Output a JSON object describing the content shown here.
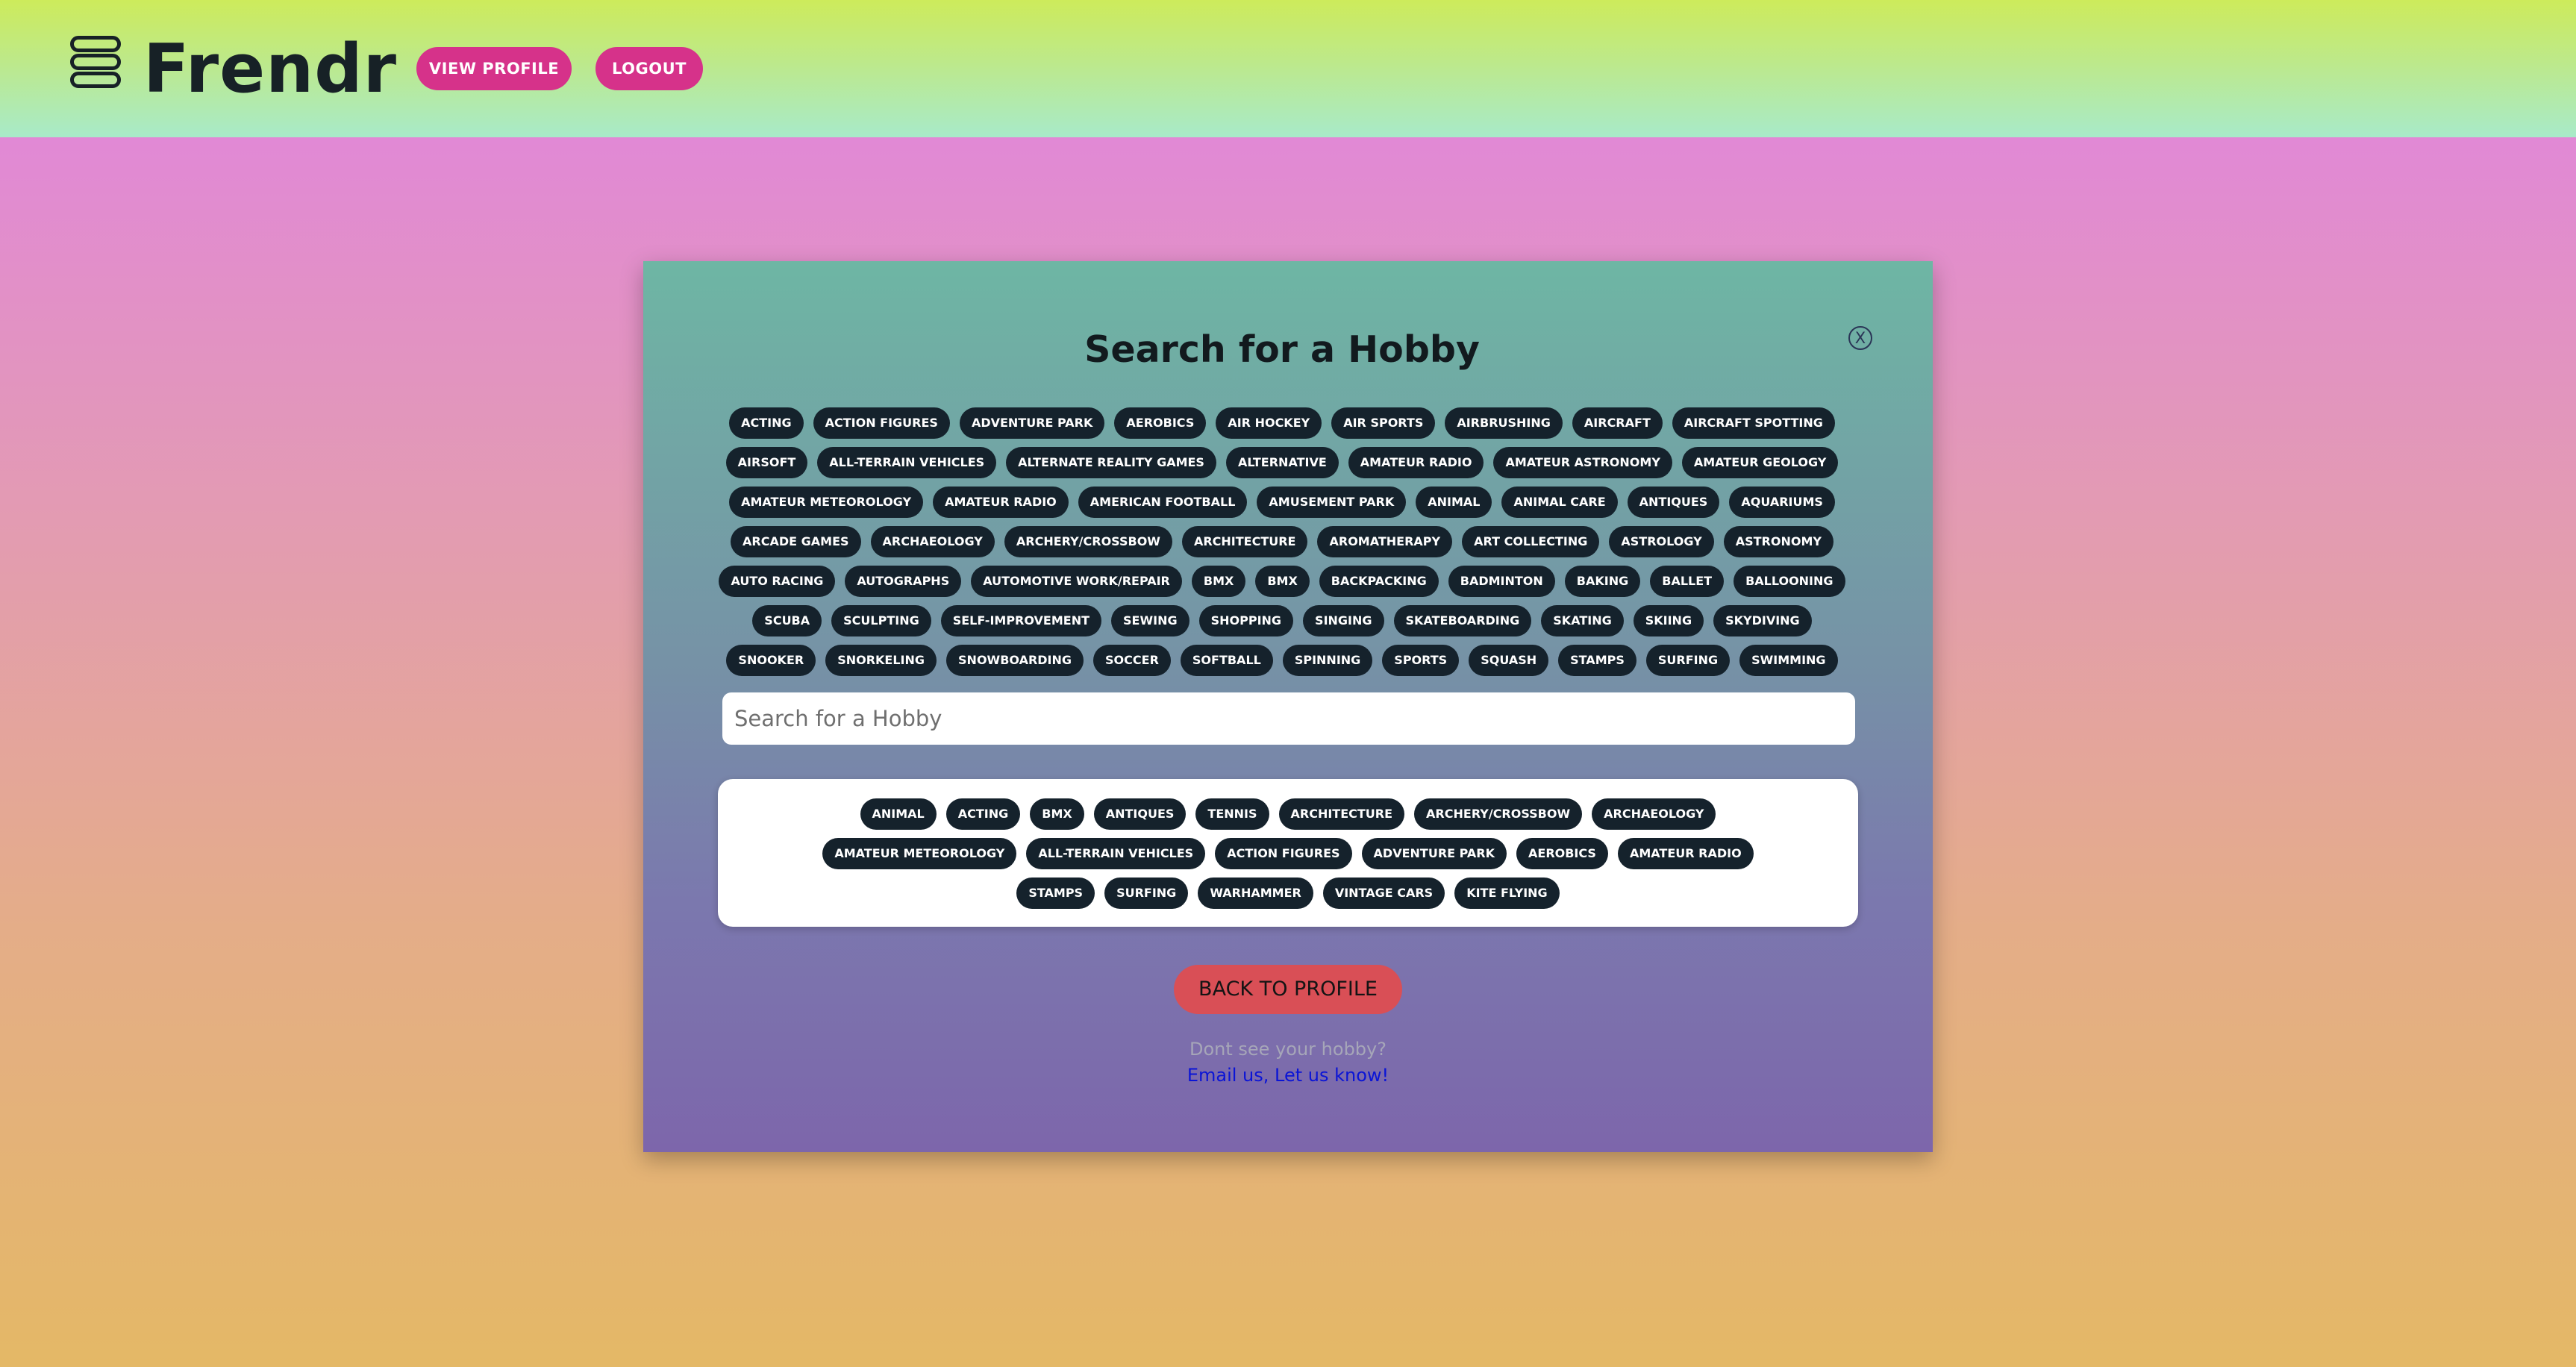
{
  "header": {
    "brand": "Frendr",
    "view_profile": "VIEW PROFILE",
    "logout": "LOGOUT"
  },
  "modal": {
    "title": "Search for a Hobby",
    "close_label": "X",
    "search_placeholder": "Search for a Hobby",
    "back_label": "BACK TO PROFILE",
    "hint": "Dont see your hobby?",
    "email_link": "Email us, Let us know!"
  },
  "hobby_rows": [
    [
      "ACTING",
      "ACTION FIGURES",
      "ADVENTURE PARK",
      "AEROBICS",
      "AIR HOCKEY",
      "AIR SPORTS",
      "AIRBRUSHING",
      "AIRCRAFT",
      "AIRCRAFT SPOTTING"
    ],
    [
      "AIRSOFT",
      "ALL-TERRAIN VEHICLES",
      "ALTERNATE REALITY GAMES",
      "ALTERNATIVE",
      "AMATEUR RADIO",
      "AMATEUR ASTRONOMY",
      "AMATEUR GEOLOGY"
    ],
    [
      "AMATEUR METEOROLOGY",
      "AMATEUR RADIO",
      "AMERICAN FOOTBALL",
      "AMUSEMENT PARK",
      "ANIMAL",
      "ANIMAL CARE",
      "ANTIQUES",
      "AQUARIUMS"
    ],
    [
      "ARCADE GAMES",
      "ARCHAEOLOGY",
      "ARCHERY/CROSSBOW",
      "ARCHITECTURE",
      "AROMATHERAPY",
      "ART COLLECTING",
      "ASTROLOGY",
      "ASTRONOMY"
    ],
    [
      "AUTO RACING",
      "AUTOGRAPHS",
      "AUTOMOTIVE WORK/REPAIR",
      "BMX",
      "BMX",
      "BACKPACKING",
      "BADMINTON",
      "BAKING",
      "BALLET",
      "BALLOONING"
    ],
    [
      "SCUBA",
      "SCULPTING",
      "SELF-IMPROVEMENT",
      "SEWING",
      "SHOPPING",
      "SINGING",
      "SKATEBOARDING",
      "SKATING",
      "SKIING",
      "SKYDIVING"
    ],
    [
      "SNOOKER",
      "SNORKELING",
      "SNOWBOARDING",
      "SOCCER",
      "SOFTBALL",
      "SPINNING",
      "SPORTS",
      "SQUASH",
      "STAMPS",
      "SURFING",
      "SWIMMING"
    ]
  ],
  "selected_rows": [
    [
      "ANIMAL",
      "ACTING",
      "BMX",
      "ANTIQUES",
      "TENNIS",
      "ARCHITECTURE",
      "ARCHERY/CROSSBOW",
      "ARCHAEOLOGY"
    ],
    [
      "AMATEUR METEOROLOGY",
      "ALL-TERRAIN VEHICLES",
      "ACTION FIGURES",
      "ADVENTURE PARK",
      "AEROBICS",
      "AMATEUR RADIO"
    ],
    [
      "STAMPS",
      "SURFING",
      "WARHAMMER",
      "VINTAGE CARS",
      "KITE FLYING"
    ]
  ],
  "colors": {
    "accent_pink": "#d6328a",
    "chip_dark": "#15222c",
    "back_button": "#d94f56",
    "link_blue": "#0a14d6"
  }
}
